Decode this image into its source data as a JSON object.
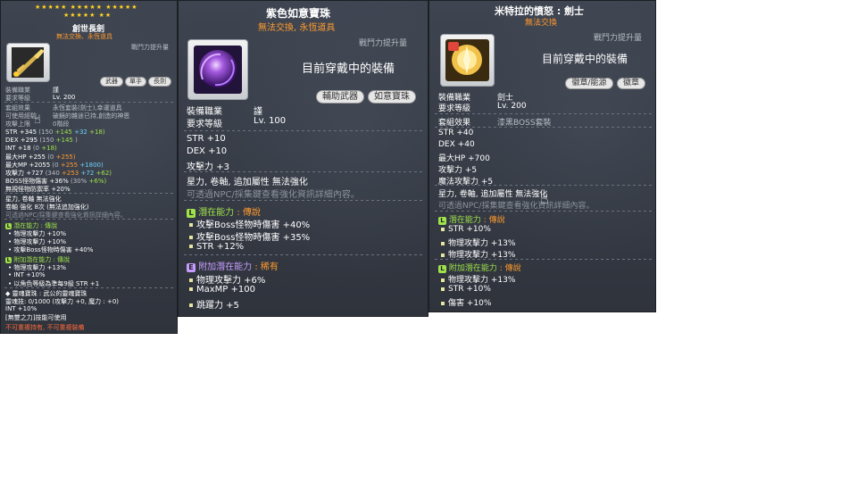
{
  "panel1": {
    "stars_row1": "★★★★★ ★★★★★ ★★★★★",
    "stars_row2": "★★★★★ ★★",
    "title": "創世長劍",
    "subtitle": "無法交換、永恆道具",
    "combat_power_label": "戰鬥力提升量",
    "tags": [
      "武器",
      "單手",
      "長劍"
    ],
    "job_label": "裝備職業",
    "job_value": "謹",
    "level_label": "要求等級",
    "level_value": "Lv. 200",
    "set_effect_label": "套組效果",
    "set_effect_value": "永恆套裝(劍士),幸運道具",
    "usable_label": "可使用經驗",
    "usable_value": "破鏡的雜途已持,創造的神恩",
    "atk_limit_label": "攻擊上限",
    "atk_limit_value": "0階段",
    "stats": [
      {
        "name": "STR",
        "total": "+345",
        "parts": "(150",
        "a": "+145",
        "b": "+32",
        "c": "+18)"
      },
      {
        "name": "DEX",
        "total": "+295",
        "parts": "(150",
        "a": "+145",
        "b": ")",
        "c": ""
      },
      {
        "name": "INT",
        "total": "+18",
        "parts": "(0",
        "a": "+18)",
        "b": "",
        "c": ""
      },
      {
        "name": "最大HP",
        "total": "+255",
        "parts": "(0",
        "a": "+255)",
        "b": "",
        "c": ""
      },
      {
        "name": "最大MP",
        "total": "+2055",
        "parts": "(0",
        "a": "+255",
        "b": "+1800)",
        "c": ""
      },
      {
        "name": "攻擊力",
        "total": "+727",
        "parts": "(340",
        "a": "+253",
        "b": "+72",
        "c": "+62)"
      },
      {
        "name": "BOSS怪物傷害",
        "total": "+36%",
        "parts": "(30%",
        "a": "+6%)",
        "b": "",
        "c": ""
      }
    ],
    "ignore_def": "無視怪物防禦率 +20%",
    "star_force": "星力, 卷軸 無法強化",
    "enhance": "卷軸 強化 8次 (無法追加強化)",
    "npc_note": "可透過NPC/採集鍵查看強化資訊詳細內容。",
    "potential_title": "潛在能力 : 傳說",
    "potential_lines": [
      "物理攻擊力 +10%",
      "物理攻擊力 +10%",
      "攻擊Boss怪物時傷害 +40%"
    ],
    "bonus_title": "附加潛在能力 : 傳說",
    "bonus_lines": [
      "物理攻擊力 +13%",
      "INT +10%",
      "以角色等級為準每9級 STR +1"
    ],
    "soul_title": "武公的靈魂寶珠",
    "soul_label": "靈魂寶珠",
    "soul_effect": "靈魂技: 0/1000 (攻擊力 +0, 魔力 : +0)",
    "soul_int": "INT +10%",
    "skill_note": "[無雙之力]技能可使用",
    "warning": "不可重複持有, 不可重複裝備"
  },
  "panel2": {
    "title": "紫色如意寶珠",
    "subtitle": "無法交換, 永恆道具",
    "combat_power_label": "戰鬥力提升量",
    "equipped": "目前穿戴中的裝備",
    "tags": [
      "輔助武器",
      "如意寶珠"
    ],
    "job_label": "裝備職業",
    "job_value": "謹",
    "level_label": "要求等級",
    "level_value": "Lv. 100",
    "stats": [
      {
        "name": "STR",
        "value": "+10"
      },
      {
        "name": "DEX",
        "value": "+10"
      },
      {
        "name": "攻擊力",
        "value": "+3"
      }
    ],
    "star_force": "星力, 卷軸, 追加屬性 無法強化",
    "npc_note": "可透過NPC/採集鍵查看強化資訊詳細內容。",
    "potential_label": "潛在能力",
    "potential_grade": ": 傳說",
    "potential_lines": [
      "攻擊Boss怪物時傷害 +40%",
      "攻擊Boss怪物時傷害 +35%",
      "STR +12%"
    ],
    "bonus_label": "附加潛在能力",
    "bonus_grade": ": 稀有",
    "bonus_lines": [
      "物理攻擊力 +6%",
      "MaxMP +100",
      "跳躍力 +5"
    ],
    "badge_L": "L",
    "badge_E": "E"
  },
  "panel3": {
    "title": "米特拉的憤怒 : 劍士",
    "subtitle": "無法交換",
    "combat_power_label": "戰鬥力提升量",
    "equipped": "目前穿戴中的裝備",
    "tags": [
      "徽章/能源",
      "徽章"
    ],
    "job_label": "裝備職業",
    "job_value": "劍士",
    "level_label": "要求等級",
    "level_value": "Lv. 200",
    "set_label": "套組效果",
    "set_value": "漆黑BOSS套裝",
    "stats": [
      {
        "name": "STR",
        "value": "+40"
      },
      {
        "name": "DEX",
        "value": "+40"
      },
      {
        "name": "最大HP",
        "value": "+700"
      },
      {
        "name": "攻擊力",
        "value": "+5"
      },
      {
        "name": "魔法攻擊力",
        "value": "+5"
      }
    ],
    "star_force": "星力, 卷軸, 追加屬性 無法強化",
    "npc_note": "可透過NPC/採集鍵查看強化資訊詳細內容。",
    "potential_label": "潛在能力",
    "potential_grade": ": 傳說",
    "potential_lines": [
      "STR +10%",
      "物理攻擊力 +13%",
      "物理攻擊力 +13%"
    ],
    "bonus_label": "附加潛在能力",
    "bonus_grade": ": 傳說",
    "bonus_lines": [
      "物理攻擊力 +13%",
      "STR +10%",
      "傷害 +10%"
    ],
    "badge_L": "L"
  },
  "colors": {
    "orange": "#ff9a2e",
    "legendary": "#9fe24b",
    "rare": "#c79cff",
    "bonus_cyan": "#6ed2ff"
  }
}
